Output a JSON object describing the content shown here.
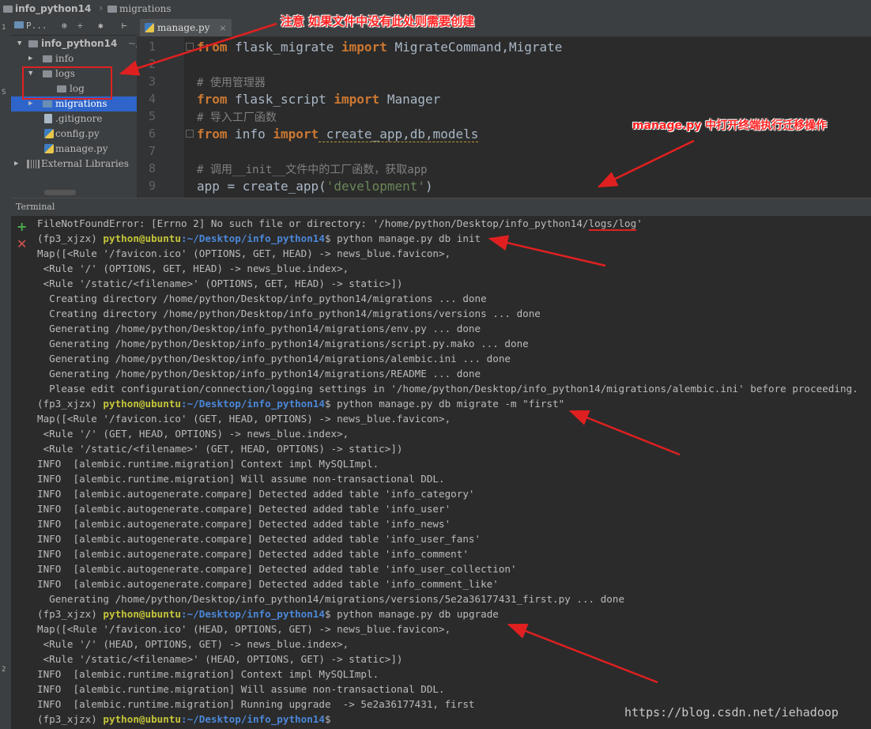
{
  "breadcrumb": {
    "project": "info_python14",
    "folder": "migrations"
  },
  "project_panel": {
    "toolbar_label": "P...",
    "root": "info_python14",
    "root_suffix": "~/",
    "items": [
      {
        "label": "info",
        "type": "folder"
      },
      {
        "label": "logs",
        "type": "folder"
      },
      {
        "label": "log",
        "type": "folder"
      },
      {
        "label": "migrations",
        "type": "folder",
        "selected": true
      },
      {
        "label": ".gitignore",
        "type": "file"
      },
      {
        "label": "config.py",
        "type": "py"
      },
      {
        "label": "manage.py",
        "type": "py"
      },
      {
        "label": "External Libraries",
        "type": "lib"
      }
    ]
  },
  "editor": {
    "tab": "manage.py",
    "line_numbers": [
      "1",
      "2",
      "3",
      "4",
      "5",
      "6",
      "7",
      "8",
      "9"
    ],
    "lines": {
      "l1_kw1": "from",
      "l1_mod": " flask_migrate ",
      "l1_kw2": "import",
      "l1_rest": " MigrateCommand,Migrate",
      "l3": "# 使用管理器",
      "l4_kw1": "from",
      "l4_mod": " flask_script ",
      "l4_kw2": "import",
      "l4_rest": " Manager",
      "l5": "# 导入工厂函数",
      "l6_kw1": "from",
      "l6_mod": " info ",
      "l6_kw2": "import",
      "l6_rest": " create_app,db,models",
      "l8": "# 调用__init__文件中的工厂函数，获取app",
      "l9_a": "app = create_app(",
      "l9_str": "'development'",
      "l9_b": ")"
    }
  },
  "terminal": {
    "header": "Terminal",
    "prompt_env": "(fp3_xjzx) ",
    "prompt_user": "python@ubuntu",
    "prompt_path": ":~/Desktop/info_python14",
    "prompt_end": "$ ",
    "error_a": "FileNotFoundError: [Errno 2] No such file or directory: '/home/python/Desktop/info_python14/",
    "error_b": "logs/log",
    "error_c": "'",
    "cmd_init": "python manage.py db init",
    "cmd_migrate": "python manage.py db migrate -m \"first\"",
    "cmd_upgrade": "python manage.py db upgrade",
    "init_out": [
      "Map([<Rule '/favicon.ico' (OPTIONS, GET, HEAD) -> news_blue.favicon>,",
      " <Rule '/' (OPTIONS, GET, HEAD) -> news_blue.index>,",
      " <Rule '/static/<filename>' (OPTIONS, GET, HEAD) -> static>])",
      "  Creating directory /home/python/Desktop/info_python14/migrations ... done",
      "  Creating directory /home/python/Desktop/info_python14/migrations/versions ... done",
      "  Generating /home/python/Desktop/info_python14/migrations/env.py ... done",
      "  Generating /home/python/Desktop/info_python14/migrations/script.py.mako ... done",
      "  Generating /home/python/Desktop/info_python14/migrations/alembic.ini ... done",
      "  Generating /home/python/Desktop/info_python14/migrations/README ... done",
      "  Please edit configuration/connection/logging settings in '/home/python/Desktop/info_python14/migrations/alembic.ini' before proceeding."
    ],
    "migrate_out": [
      "Map([<Rule '/favicon.ico' (GET, HEAD, OPTIONS) -> news_blue.favicon>,",
      " <Rule '/' (GET, HEAD, OPTIONS) -> news_blue.index>,",
      " <Rule '/static/<filename>' (GET, HEAD, OPTIONS) -> static>])",
      "INFO  [alembic.runtime.migration] Context impl MySQLImpl.",
      "INFO  [alembic.runtime.migration] Will assume non-transactional DDL.",
      "INFO  [alembic.autogenerate.compare] Detected added table 'info_category'",
      "INFO  [alembic.autogenerate.compare] Detected added table 'info_user'",
      "INFO  [alembic.autogenerate.compare] Detected added table 'info_news'",
      "INFO  [alembic.autogenerate.compare] Detected added table 'info_user_fans'",
      "INFO  [alembic.autogenerate.compare] Detected added table 'info_comment'",
      "INFO  [alembic.autogenerate.compare] Detected added table 'info_user_collection'",
      "INFO  [alembic.autogenerate.compare] Detected added table 'info_comment_like'",
      "  Generating /home/python/Desktop/info_python14/migrations/versions/5e2a36177431_first.py ... done"
    ],
    "upgrade_out": [
      "Map([<Rule '/favicon.ico' (HEAD, OPTIONS, GET) -> news_blue.favicon>,",
      " <Rule '/' (HEAD, OPTIONS, GET) -> news_blue.index>,",
      " <Rule '/static/<filename>' (HEAD, OPTIONS, GET) -> static>])",
      "INFO  [alembic.runtime.migration] Context impl MySQLImpl.",
      "INFO  [alembic.runtime.migration] Will assume non-transactional DDL.",
      "INFO  [alembic.runtime.migration] Running upgrade  -> 5e2a36177431, first"
    ]
  },
  "annotations": {
    "note_logs": "注意 如果文件中没有此处则需要创建",
    "note_terminal": "manage.py 中打开终端执行迁移操作"
  },
  "watermark": "https://blog.csdn.net/iehadoop",
  "colors": {
    "annotation_red": "#ff2020",
    "keyword": "#cc7832",
    "string": "#6a8759",
    "selection": "#2f65ca"
  }
}
